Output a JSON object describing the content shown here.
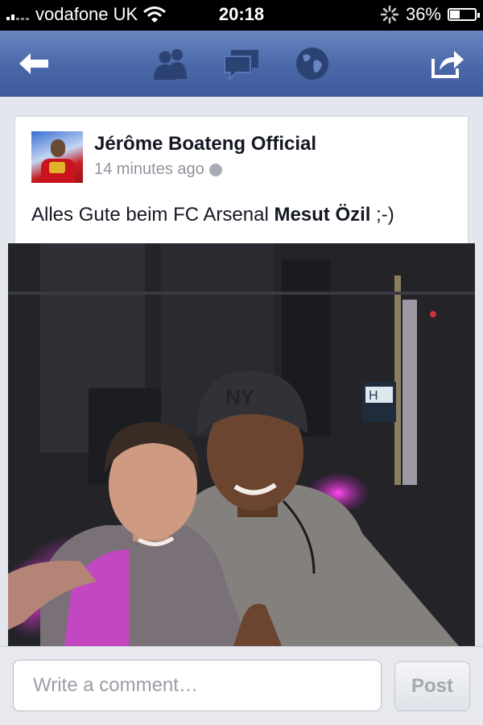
{
  "status_bar": {
    "carrier": "vodafone UK",
    "time": "20:18",
    "battery_percent": "36%",
    "battery_level": 0.36,
    "icons": [
      "signal-icon",
      "wifi-icon",
      "activity-spinner-icon",
      "battery-icon"
    ]
  },
  "nav_bar": {
    "icons": [
      "back-arrow-icon",
      "friend-requests-icon",
      "messages-icon",
      "notifications-globe-icon",
      "share-icon"
    ],
    "colors": {
      "bar_top": "#6a86c0",
      "bar_bottom": "#3f5c9c",
      "icon": "#2c4273"
    }
  },
  "post": {
    "author": "Jérôme Boateng Official",
    "timestamp": "14 minutes ago",
    "privacy_icon": "globe-icon",
    "message_text": "Alles Gute beim FC Arsenal ",
    "tagged_name": "Mesut Özil",
    "message_suffix": " ;-)"
  },
  "photo": {
    "cap_text": "NY",
    "screen_text": "H"
  },
  "comment": {
    "placeholder": "Write a comment…",
    "value": "",
    "post_label": "Post"
  }
}
